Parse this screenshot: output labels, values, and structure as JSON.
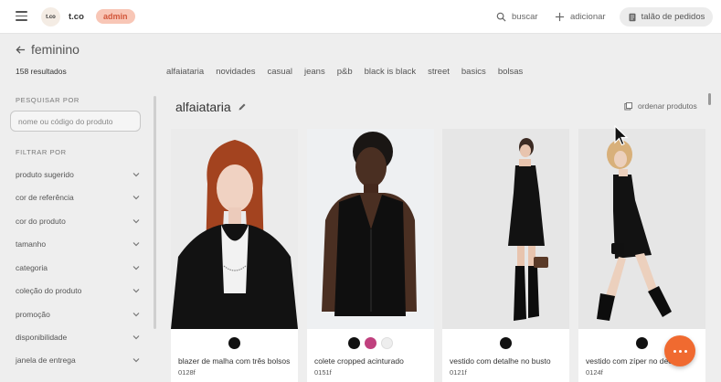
{
  "header": {
    "logo_text": "t.co",
    "brand": "t.co",
    "badge": "admin",
    "search_label": "buscar",
    "add_label": "adicionar",
    "orders_label": "talão de pedidos"
  },
  "page": {
    "title": "feminino",
    "results": "158 resultados"
  },
  "category_tabs": [
    "alfaiataria",
    "novidades",
    "casual",
    "jeans",
    "p&b",
    "black is black",
    "street",
    "basics",
    "bolsas"
  ],
  "sidebar": {
    "search_heading": "PESQUISAR POR",
    "search_placeholder": "nome ou código do produto",
    "filter_heading": "FILTRAR POR",
    "filters": [
      "produto sugerido",
      "cor de referência",
      "cor do produto",
      "tamanho",
      "categoria",
      "coleção do produto",
      "promoção",
      "disponibilidade",
      "janela de entrega"
    ]
  },
  "section": {
    "title": "alfaiataria",
    "sort_label": "ordenar produtos"
  },
  "products": [
    {
      "name": "blazer de malha com três bolsos",
      "code": "0128f",
      "swatches": [
        "#111111"
      ]
    },
    {
      "name": "colete cropped acinturado",
      "code": "0151f",
      "swatches": [
        "#111111",
        "#c0407e",
        "#eeeeee"
      ]
    },
    {
      "name": "vestido com detalhe no busto",
      "code": "0121f",
      "swatches": [
        "#111111"
      ]
    },
    {
      "name": "vestido com zíper no decote",
      "code": "0124f",
      "swatches": [
        "#111111"
      ]
    }
  ],
  "colors": {
    "accent": "#f06a30",
    "badge_bg": "#f8c6b6",
    "badge_text": "#d2563a"
  }
}
